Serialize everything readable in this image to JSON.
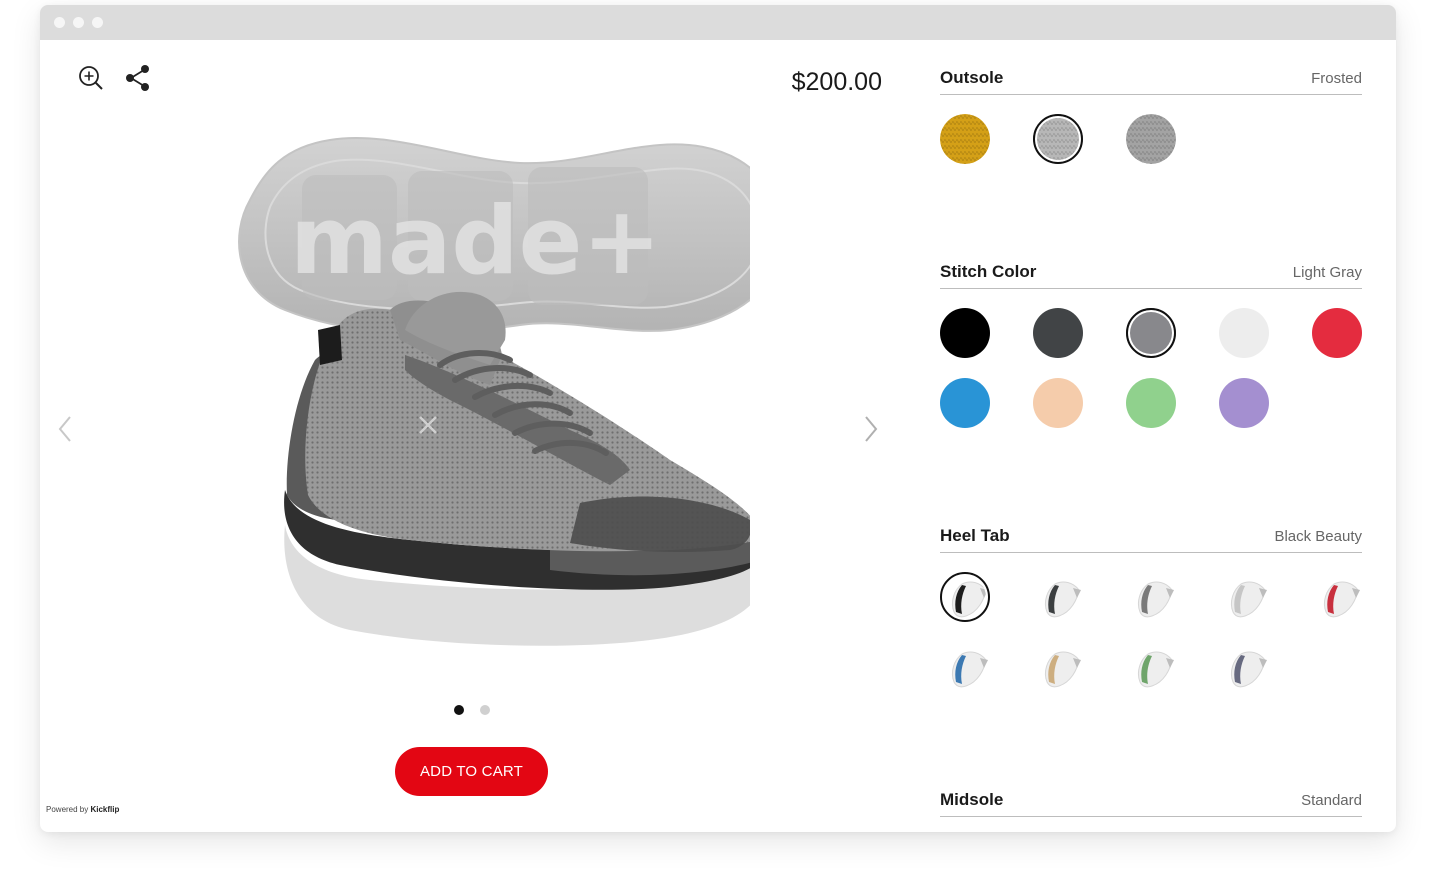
{
  "product": {
    "price": "$200.00",
    "brand_mark": "made+"
  },
  "toolbar": {
    "zoom_icon": "zoom-in-icon",
    "share_icon": "share-icon"
  },
  "carousel": {
    "total": 2,
    "active": 1
  },
  "actions": {
    "add_to_cart": "ADD TO CART"
  },
  "footer": {
    "powered_prefix": "Powered by",
    "powered_brand": "Kickflip"
  },
  "options": {
    "outsole": {
      "title": "Outsole",
      "value": "Frosted",
      "swatches": [
        {
          "color": "#d4a017",
          "kind": "texture"
        },
        {
          "color": "#b7b7b7",
          "kind": "texture",
          "selected": true
        },
        {
          "color": "#a3a3a3",
          "kind": "texture"
        }
      ]
    },
    "stitch_color": {
      "title": "Stitch Color",
      "value": "Light Gray",
      "swatches": [
        {
          "color": "#000000"
        },
        {
          "color": "#414446"
        },
        {
          "color": "#88888c",
          "selected": true
        },
        {
          "color": "#ededed"
        },
        {
          "color": "#e42c3f"
        },
        {
          "color": "#2994d6"
        },
        {
          "color": "#f5ccab"
        },
        {
          "color": "#90d18d"
        },
        {
          "color": "#a48fd0"
        }
      ]
    },
    "heel_tab": {
      "title": "Heel Tab",
      "value": "Black Beauty",
      "swatches": [
        {
          "color": "#1d1d1d",
          "selected": true
        },
        {
          "color": "#3c3f41"
        },
        {
          "color": "#7a7a7a"
        },
        {
          "color": "#c6c6c6"
        },
        {
          "color": "#c8303e"
        },
        {
          "color": "#3c79b2"
        },
        {
          "color": "#cdae80"
        },
        {
          "color": "#6fa56b"
        },
        {
          "color": "#676a80"
        }
      ]
    },
    "midsole": {
      "title": "Midsole",
      "value": "Standard"
    }
  }
}
